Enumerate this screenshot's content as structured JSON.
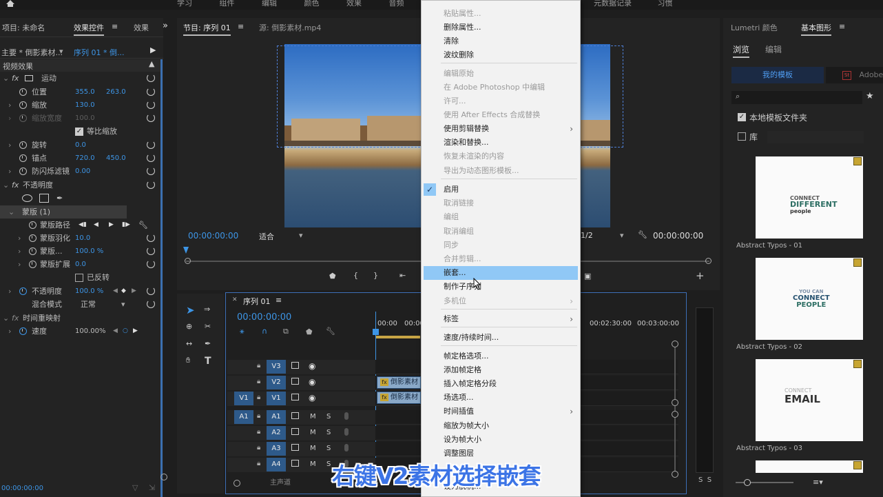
{
  "top_menu": [
    "学习",
    "组件",
    "编辑",
    "颜色",
    "效果",
    "音频",
    "元数据记录",
    "习惯"
  ],
  "effect_controls": {
    "tabs": [
      "项目: 未命名",
      "效果控件",
      "效果"
    ],
    "more": "»",
    "master": "主要 * 倒影素材...",
    "sequence": "序列 01 * 倒...",
    "section_video": "视频效果",
    "motion": "运动",
    "position_label": "位置",
    "position_x": "355.0",
    "position_y": "263.0",
    "scale_label": "缩放",
    "scale_val": "130.0",
    "scale_width_label": "缩放宽度",
    "scale_width_val": "100.0",
    "uniform_label": "等比缩放",
    "rotation_label": "旋转",
    "rotation_val": "0.0",
    "anchor_label": "锚点",
    "anchor_x": "720.0",
    "anchor_y": "450.0",
    "antiflicker_label": "防闪烁滤镜",
    "antiflicker_val": "0.00",
    "opacity_section": "不透明度",
    "mask_label": "蒙版 (1)",
    "mask_path_label": "蒙版路径",
    "mask_feather_label": "蒙版羽化",
    "mask_feather_val": "10.0",
    "mask_opacity_label": "蒙版...",
    "mask_opacity_val": "100.0 %",
    "mask_expand_label": "蒙版扩展",
    "mask_expand_val": "0.0",
    "inverted_label": "已反转",
    "opacity_label": "不透明度",
    "opacity_val": "100.0 %",
    "blend_label": "混合模式",
    "blend_val": "正常",
    "time_remap": "时间重映射",
    "speed_label": "速度",
    "speed_val": "100.00%",
    "bottom_time": "00:00:00:00"
  },
  "program_monitor": {
    "tab_program": "节目: 序列 01",
    "tab_source": "源: 倒影素材.mp4",
    "timecode": "00:00:00:00",
    "fit": "适合",
    "quality": "1/2",
    "timecode_right": "00:00:00:00"
  },
  "timeline": {
    "tab": "序列 01",
    "timecode": "00:00:00:00",
    "ruler": [
      "00:00",
      "00:00",
      "00:02:30:00",
      "00:03:00:00"
    ],
    "tracks": [
      {
        "src": "",
        "name": "V3"
      },
      {
        "src": "",
        "name": "V2"
      },
      {
        "src": "V1",
        "name": "V1"
      },
      {
        "src": "A1",
        "name": "A1"
      },
      {
        "src": "",
        "name": "A2"
      },
      {
        "src": "",
        "name": "A3"
      },
      {
        "src": "",
        "name": "A4"
      }
    ],
    "mute": "M",
    "solo": "S",
    "clip_v2": "倒影素材",
    "clip_v1": "倒影素材",
    "master_label": "主声道",
    "meter_labels": "S  S"
  },
  "context_menu": {
    "items": [
      {
        "label": "粘贴属性...",
        "dis": true
      },
      {
        "label": "删除属性...",
        "dis": false
      },
      {
        "label": "清除",
        "dis": false
      },
      {
        "label": "波纹删除",
        "dis": false
      },
      {
        "label": "编辑原始",
        "dis": true
      },
      {
        "label": "在 Adobe Photoshop 中编辑",
        "dis": true
      },
      {
        "label": "许可...",
        "dis": true
      },
      {
        "label": "使用 After Effects 合成替换",
        "dis": true
      },
      {
        "label": "使用剪辑替换",
        "dis": false
      },
      {
        "label": "渲染和替换...",
        "dis": false
      },
      {
        "label": "恢复未渲染的内容",
        "dis": true
      },
      {
        "label": "导出为动态图形模板...",
        "dis": true
      },
      {
        "label": "启用",
        "dis": false
      },
      {
        "label": "取消链接",
        "dis": true
      },
      {
        "label": "编组",
        "dis": true
      },
      {
        "label": "取消编组",
        "dis": true
      },
      {
        "label": "同步",
        "dis": true
      },
      {
        "label": "合并剪辑...",
        "dis": true
      },
      {
        "label": "嵌套...",
        "dis": false
      },
      {
        "label": "制作子序列",
        "dis": false
      },
      {
        "label": "多机位",
        "dis": true
      },
      {
        "label": "标签",
        "dis": false
      },
      {
        "label": "速度/持续时间...",
        "dis": false
      },
      {
        "label": "帧定格选项...",
        "dis": false
      },
      {
        "label": "添加帧定格",
        "dis": false
      },
      {
        "label": "插入帧定格分段",
        "dis": false
      },
      {
        "label": "场选项...",
        "dis": false
      },
      {
        "label": "时间插值",
        "dis": false
      },
      {
        "label": "缩放为帧大小",
        "dis": false
      },
      {
        "label": "设为帧大小",
        "dis": false
      },
      {
        "label": "调整图层",
        "dis": false
      },
      {
        "label": "设为脱机...",
        "dis": false
      }
    ]
  },
  "essential_graphics": {
    "tab_lumetri": "Lumetri 颜色",
    "tab_eg": "基本图形",
    "subtab_browse": "浏览",
    "subtab_edit": "编辑",
    "my_templates": "我的模板",
    "adobe_stock": "Adobe St",
    "local_folder": "本地模板文件夹",
    "library": "库",
    "thumbs": [
      {
        "label": "Abstract Typos - 01",
        "line1": "CONNECT",
        "line2": "DIFFERENT",
        "line3": "people"
      },
      {
        "label": "Abstract Typos - 02",
        "line1": "YOU CAN",
        "line2": "CONNECT",
        "line3": "PEOPLE"
      },
      {
        "label": "Abstract Typos - 03",
        "line1": "CONNECT",
        "line2": "EMAIL",
        "line3": ""
      }
    ]
  },
  "subtitle": "右键V2素材选择嵌套"
}
